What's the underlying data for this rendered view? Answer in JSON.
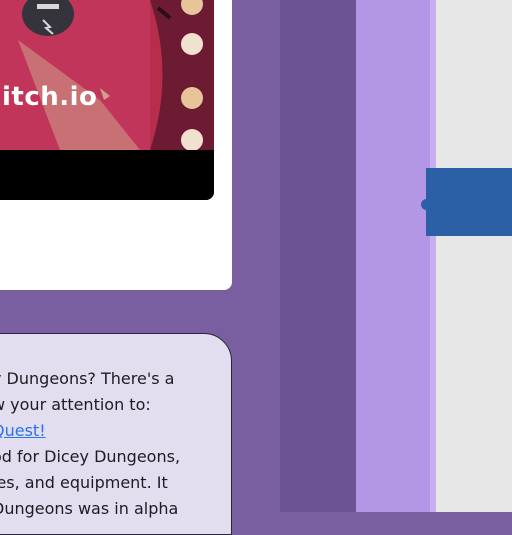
{
  "colors": {
    "background_purple": "#7a5fa0",
    "light_purple": "#b496e6",
    "link_blue": "#2a73e8",
    "tab_blue": "#2b5fa6"
  },
  "media": {
    "logo_text": "itch.io",
    "logo_icon": "itch-io-logo-icon"
  },
  "description": {
    "line1": "y Dungeons? There's a",
    "line2": "w your attention to:",
    "link": "Quest!",
    "line4": "od for Dicey Dungeons,",
    "line5": "ies, and equipment. It",
    "line6": "Dungeons was in alpha"
  }
}
